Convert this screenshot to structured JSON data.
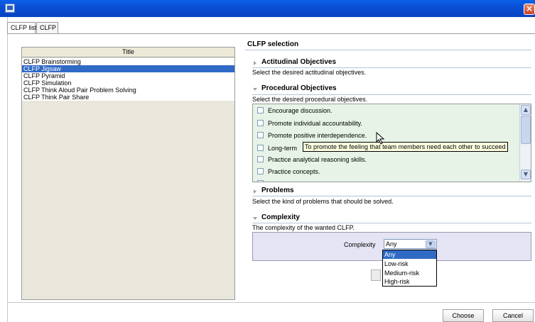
{
  "window": {
    "close_glyph": "×"
  },
  "tabs": [
    {
      "label": "CLFP list",
      "active": true
    },
    {
      "label": "CLFP",
      "active": false
    }
  ],
  "list": {
    "header": "Title",
    "items": [
      {
        "label": "CLFP Brainstorming",
        "selected": false
      },
      {
        "label": "CLFP Jigsaw",
        "selected": true
      },
      {
        "label": "CLFP Pyramid",
        "selected": false
      },
      {
        "label": "CLFP Simulation",
        "selected": false
      },
      {
        "label": "CLFP Think Aloud Pair Problem Solving",
        "selected": false
      },
      {
        "label": "CLFP Think Pair Share",
        "selected": false
      }
    ]
  },
  "selection": {
    "title": "CLFP selection",
    "actitudinal": {
      "title": "Actitudinal Objectives",
      "desc": "Select the desired actitudinal objectives."
    },
    "procedural": {
      "title": "Procedural Objectives",
      "desc": "Select the desired procedural objectives.",
      "options": [
        "Encourage discussion.",
        "Promote individual accountability.",
        "Promote positive interdependence.",
        "Long-term",
        "Practice analytical reasoning skills.",
        "Practice concepts."
      ],
      "tooltip": "To promote the feeling that team members need each other to succeed"
    },
    "problems": {
      "title": "Problems",
      "desc": "Select the kind of problems that should be solved."
    },
    "complexity": {
      "title": "Complexity",
      "desc": "The complexity of the wanted CLFP.",
      "label": "Complexity",
      "value": "Any",
      "options": [
        "Any",
        "Low-risk",
        "Medium-risk",
        "High-risk"
      ]
    }
  },
  "buttons": {
    "choose": "Choose",
    "cancel": "Cancel"
  },
  "colors": {
    "titlebar": "#0a4fd6",
    "selection": "#316ac5",
    "objectives_bg": "#e6f3e6",
    "complexity_bg": "#e4e4f4"
  },
  "icons": {
    "collapsed": "triangle-right-icon",
    "expanded": "triangle-down-icon",
    "app": "app-window-icon",
    "close": "close-icon",
    "cursor": "mouse-pointer-icon"
  }
}
